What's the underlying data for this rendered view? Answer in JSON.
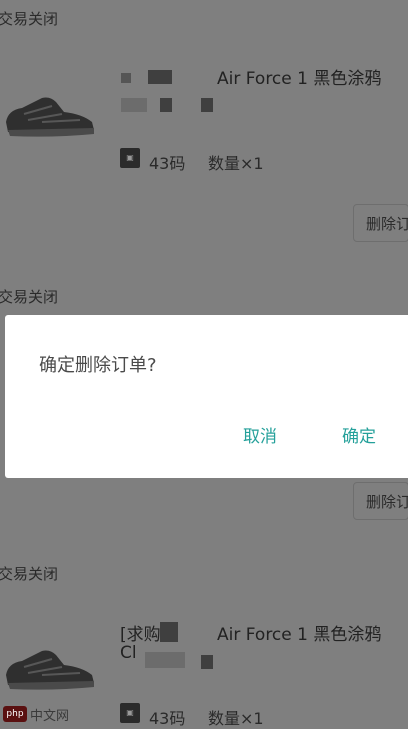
{
  "orders": [
    {
      "status": "交易关闭",
      "title": "Air Force 1 黑色涂鸦",
      "size": "43码",
      "quantity": "数量×1",
      "delete_label": "删除订单"
    },
    {
      "status": "交易关闭",
      "delete_label": "删除订单"
    },
    {
      "status": "交易关闭",
      "title": "Air Force 1 黑色涂鸦",
      "title_prefix": "[求购",
      "title_line2": "Cl",
      "size": "43码",
      "quantity": "数量×1"
    }
  ],
  "dialog": {
    "message": "确定删除订单?",
    "cancel_label": "取消",
    "confirm_label": "确定"
  },
  "watermark": {
    "logo": "php",
    "text": "中文网"
  },
  "colors": {
    "overlay": "#7f7f7f",
    "dialog_bg": "#ffffff",
    "accent": "#24a09a"
  }
}
